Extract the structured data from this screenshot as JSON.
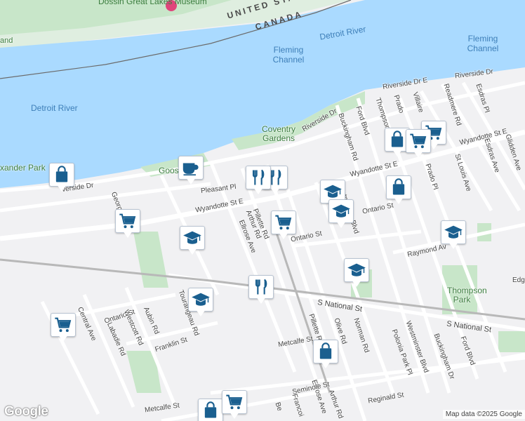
{
  "map": {
    "attribution": "Map data ©2025 Google",
    "logo": "Google",
    "colors": {
      "water": "#aadaff",
      "land": "#f1f1f3",
      "park": "#c8e6c9",
      "road": "#ffffff",
      "rail": "#b0b0b0",
      "marker_icon": "#1a5f8f"
    }
  },
  "labels": {
    "museum": "Dossin Great Lakes Museum",
    "border_us": "UNITED STATES",
    "border_ca": "CANADA",
    "detroit_river_top": "Detroit River",
    "detroit_river_left": "Detroit River",
    "fleming_channel_center": "Fleming Channel",
    "fleming_channel_right": "Fleming Channel",
    "coventry_gardens": "Coventry Gardens",
    "goose_pk": "Goose Pk",
    "alexander_park": "xander Park",
    "thompson_park": "Thompson Park",
    "land_partial": "and"
  },
  "streets": [
    {
      "id": "riverside-dr-e",
      "text": "Riverside Dr E"
    },
    {
      "id": "riverside-dr-right",
      "text": "Riverside Dr"
    },
    {
      "id": "riverside-dr-mid",
      "text": "Riverside Dr"
    },
    {
      "id": "riverside-dr-left",
      "text": "verside Dr"
    },
    {
      "id": "wyandotte-st-e-mid",
      "text": "Wyandotte St E"
    },
    {
      "id": "wyandotte-st-e-right",
      "text": "Wyandotte St E"
    },
    {
      "id": "wyandotte-st-e-left",
      "text": "Wyandotte St E"
    },
    {
      "id": "pleasant-pl",
      "text": "Pleasant Pl"
    },
    {
      "id": "pillette-rd",
      "text": "Pillette Rd"
    },
    {
      "id": "pillette-rd-lower",
      "text": "Pillette Rd"
    },
    {
      "id": "ellrose-ave",
      "text": "Ellrose Ave"
    },
    {
      "id": "ellrose-ave-lower",
      "text": "Ellrose Ave"
    },
    {
      "id": "arthur-rd",
      "text": "Arthur Rd"
    },
    {
      "id": "arthur-rd-lower",
      "text": "Arthur Rd"
    },
    {
      "id": "ontario-st-mid",
      "text": "Ontario St"
    },
    {
      "id": "ontario-st-right",
      "text": "Ontario St"
    },
    {
      "id": "ontario-st-left",
      "text": "Ontario St"
    },
    {
      "id": "buckingham-rd",
      "text": "Buckingham Rd"
    },
    {
      "id": "buckingham-dr",
      "text": "Buckingham Dr"
    },
    {
      "id": "ford-blvd",
      "text": "Ford Blvd"
    },
    {
      "id": "ford-blvd-lower",
      "text": "Ford Blvd"
    },
    {
      "id": "thompson",
      "text": "Thompson"
    },
    {
      "id": "prado",
      "text": "Prado"
    },
    {
      "id": "prado-pl",
      "text": "Prado Pl"
    },
    {
      "id": "villaire",
      "text": "Villaire"
    },
    {
      "id": "readmere-rd",
      "text": "Readmere Rd"
    },
    {
      "id": "esdras-pl",
      "text": "Esdras Pl"
    },
    {
      "id": "esdras-ave",
      "text": "Esdras Ave"
    },
    {
      "id": "st-louis-ave",
      "text": "St Louis Ave"
    },
    {
      "id": "glidden-ave",
      "text": "Glidden Ave"
    },
    {
      "id": "westminster-blvd-upper",
      "text": "estminster Blvd"
    },
    {
      "id": "westminster-blvd",
      "text": "Westminster Blvd"
    },
    {
      "id": "raymond-ave",
      "text": "Raymond Av"
    },
    {
      "id": "edg",
      "text": "Edg"
    },
    {
      "id": "s-national-st-left",
      "text": "S National St"
    },
    {
      "id": "s-national-st-right",
      "text": "S National St"
    },
    {
      "id": "olive-rd",
      "text": "Olive Rd"
    },
    {
      "id": "norman-rd",
      "text": "Norman Rd"
    },
    {
      "id": "polonia-park-pl",
      "text": "Polonia Park Pl"
    },
    {
      "id": "metcalfe-st",
      "text": "Metcalfe St"
    },
    {
      "id": "metcalfe-st-left",
      "text": "Metcalfe St"
    },
    {
      "id": "seminole-st",
      "text": "Seminole St"
    },
    {
      "id": "reginald-st",
      "text": "Reginald St"
    },
    {
      "id": "francois",
      "text": "Francoi"
    },
    {
      "id": "be",
      "text": "Be"
    },
    {
      "id": "central-ave",
      "text": "Central Ave"
    },
    {
      "id": "labadie-rd",
      "text": "Labadie Rd"
    },
    {
      "id": "westcott-rd",
      "text": "Westcott Rd"
    },
    {
      "id": "aubin-rd",
      "text": "Aubin Rd"
    },
    {
      "id": "franklin-st",
      "text": "Franklin St"
    },
    {
      "id": "tourangeau-rd",
      "text": "Tourangeau Rd"
    },
    {
      "id": "georg",
      "text": "Georg"
    }
  ],
  "markers": [
    {
      "type": "coffee",
      "icon": "coffee-cup-icon"
    },
    {
      "type": "shopping",
      "icon": "shopping-bag-icon"
    },
    {
      "type": "grocery",
      "icon": "shopping-cart-icon"
    },
    {
      "type": "school",
      "icon": "graduation-cap-icon"
    },
    {
      "type": "restaurant",
      "icon": "fork-knife-icon"
    }
  ]
}
